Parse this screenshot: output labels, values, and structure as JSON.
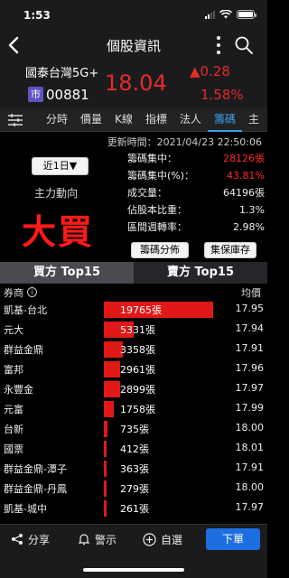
{
  "status_bar": {
    "time": "1:53"
  },
  "nav": {
    "title": "個股資訊"
  },
  "quote": {
    "name": "國泰台灣5G+",
    "market_badge": "市",
    "code": "00881",
    "price": "18.04",
    "change": "▲0.28",
    "change_pct": "1.58%",
    "up_color": "#e52a2a"
  },
  "tabs": [
    {
      "label": "分時"
    },
    {
      "label": "價量"
    },
    {
      "label": "K線"
    },
    {
      "label": "指標"
    },
    {
      "label": "法人"
    },
    {
      "label": "籌碼",
      "active": true
    },
    {
      "label": "主"
    }
  ],
  "panel": {
    "update_time": "更新時間：2021/04/23 22:50:06",
    "period_button": "近1日▼",
    "main_force_label": "主力動向",
    "verdict": "大買",
    "stats": [
      {
        "label": "籌碼集中：",
        "value": "28126張",
        "highlight": true
      },
      {
        "label": "籌碼集中(%)：",
        "value": "43.81%",
        "highlight": true
      },
      {
        "label": "成交量：",
        "value": "64196張",
        "highlight": false
      },
      {
        "label": "佔股本比重：",
        "value": "1.3%",
        "highlight": false
      },
      {
        "label": "區間週轉率：",
        "value": "2.98%",
        "highlight": false
      }
    ],
    "chip_distribution_button": "籌碼分佈",
    "inventory_button": "集保庫存"
  },
  "side_tabs": {
    "buy": "買方 Top15",
    "sell": "賣方 Top15"
  },
  "table": {
    "header_broker": "券商",
    "header_avg": "均價",
    "max_volume": 19765,
    "rows": [
      {
        "broker": "凱基-台北",
        "volume": 19765,
        "volume_text": "19765張",
        "avg": "17.95"
      },
      {
        "broker": "元大",
        "volume": 5331,
        "volume_text": "5331張",
        "avg": "17.94"
      },
      {
        "broker": "群益金鼎",
        "volume": 3358,
        "volume_text": "3358張",
        "avg": "17.91"
      },
      {
        "broker": "富邦",
        "volume": 2961,
        "volume_text": "2961張",
        "avg": "17.96"
      },
      {
        "broker": "永豐金",
        "volume": 2899,
        "volume_text": "2899張",
        "avg": "17.97"
      },
      {
        "broker": "元富",
        "volume": 1758,
        "volume_text": "1758張",
        "avg": "17.99"
      },
      {
        "broker": "台新",
        "volume": 735,
        "volume_text": "735張",
        "avg": "18.00"
      },
      {
        "broker": "國票",
        "volume": 412,
        "volume_text": "412張",
        "avg": "18.01"
      },
      {
        "broker": "群益金鼎-潭子",
        "volume": 363,
        "volume_text": "363張",
        "avg": "17.91"
      },
      {
        "broker": "群益金鼎-丹鳳",
        "volume": 279,
        "volume_text": "279張",
        "avg": "18.00"
      },
      {
        "broker": "凱基-城中",
        "volume": 261,
        "volume_text": "261張",
        "avg": "17.97"
      }
    ]
  },
  "bottom_bar": {
    "share": "分享",
    "alert": "警示",
    "watchlist": "自選",
    "order": "下單"
  }
}
